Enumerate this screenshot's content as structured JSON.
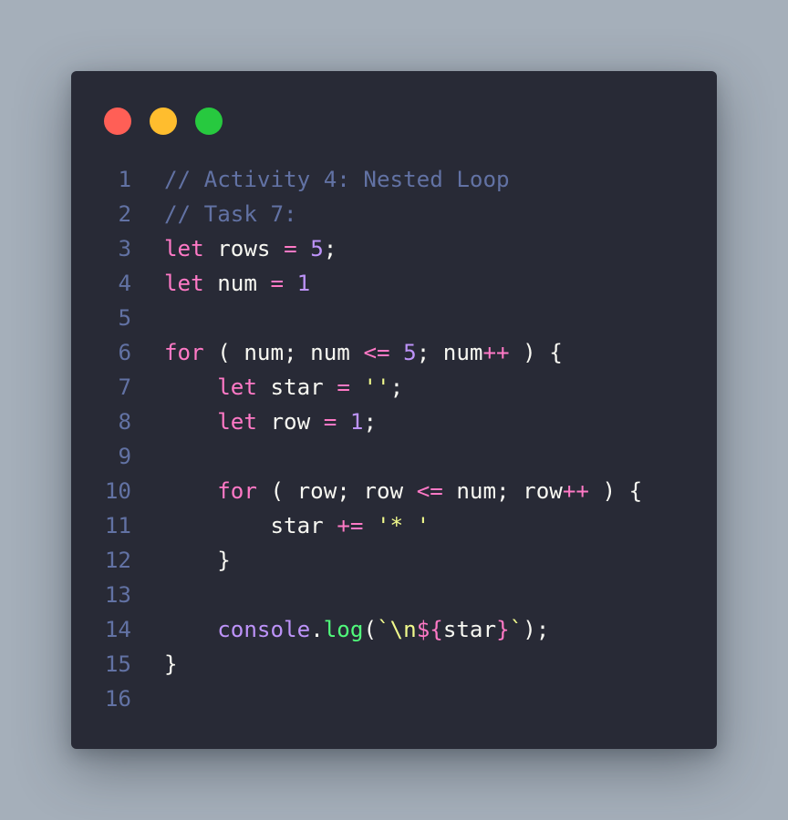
{
  "window": {
    "controls": [
      "close",
      "minimize",
      "zoom"
    ],
    "colors": {
      "background": "#282a36",
      "close": "#ff5f56",
      "minimize": "#ffbd2e",
      "zoom": "#27c93f",
      "page": "#a5afba"
    }
  },
  "code": {
    "line_numbers": [
      "1",
      "2",
      "3",
      "4",
      "5",
      "6",
      "7",
      "8",
      "9",
      "10",
      "11",
      "12",
      "13",
      "14",
      "15",
      "16"
    ],
    "lines": [
      [
        {
          "t": "comment",
          "v": "// Activity 4: Nested Loop"
        }
      ],
      [
        {
          "t": "comment",
          "v": "// Task 7:"
        }
      ],
      [
        {
          "t": "kw",
          "v": "let"
        },
        {
          "t": "txt",
          "v": " rows "
        },
        {
          "t": "op",
          "v": "="
        },
        {
          "t": "txt",
          "v": " "
        },
        {
          "t": "num",
          "v": "5"
        },
        {
          "t": "txt",
          "v": ";"
        }
      ],
      [
        {
          "t": "kw",
          "v": "let"
        },
        {
          "t": "txt",
          "v": " num "
        },
        {
          "t": "op",
          "v": "="
        },
        {
          "t": "txt",
          "v": " "
        },
        {
          "t": "num",
          "v": "1"
        }
      ],
      [],
      [
        {
          "t": "kw",
          "v": "for"
        },
        {
          "t": "txt",
          "v": " ( num; num "
        },
        {
          "t": "op",
          "v": "<="
        },
        {
          "t": "txt",
          "v": " "
        },
        {
          "t": "num",
          "v": "5"
        },
        {
          "t": "txt",
          "v": "; num"
        },
        {
          "t": "op",
          "v": "++"
        },
        {
          "t": "txt",
          "v": " ) {"
        }
      ],
      [
        {
          "t": "txt",
          "v": "    "
        },
        {
          "t": "kw",
          "v": "let"
        },
        {
          "t": "txt",
          "v": " star "
        },
        {
          "t": "op",
          "v": "="
        },
        {
          "t": "txt",
          "v": " "
        },
        {
          "t": "str",
          "v": "''"
        },
        {
          "t": "txt",
          "v": ";"
        }
      ],
      [
        {
          "t": "txt",
          "v": "    "
        },
        {
          "t": "kw",
          "v": "let"
        },
        {
          "t": "txt",
          "v": " row "
        },
        {
          "t": "op",
          "v": "="
        },
        {
          "t": "txt",
          "v": " "
        },
        {
          "t": "num",
          "v": "1"
        },
        {
          "t": "txt",
          "v": ";"
        }
      ],
      [],
      [
        {
          "t": "txt",
          "v": "    "
        },
        {
          "t": "kw",
          "v": "for"
        },
        {
          "t": "txt",
          "v": " ( row; row "
        },
        {
          "t": "op",
          "v": "<="
        },
        {
          "t": "txt",
          "v": " num; row"
        },
        {
          "t": "op",
          "v": "++"
        },
        {
          "t": "txt",
          "v": " ) {"
        }
      ],
      [
        {
          "t": "txt",
          "v": "        star "
        },
        {
          "t": "op",
          "v": "+="
        },
        {
          "t": "txt",
          "v": " "
        },
        {
          "t": "str",
          "v": "'* '"
        }
      ],
      [
        {
          "t": "txt",
          "v": "    }"
        }
      ],
      [],
      [
        {
          "t": "txt",
          "v": "    "
        },
        {
          "t": "obj",
          "v": "console"
        },
        {
          "t": "txt",
          "v": "."
        },
        {
          "t": "fn",
          "v": "log"
        },
        {
          "t": "txt",
          "v": "("
        },
        {
          "t": "str",
          "v": "`\\n"
        },
        {
          "t": "op",
          "v": "${"
        },
        {
          "t": "txt",
          "v": "star"
        },
        {
          "t": "op",
          "v": "}"
        },
        {
          "t": "str",
          "v": "`"
        },
        {
          "t": "txt",
          "v": ");"
        }
      ],
      [
        {
          "t": "txt",
          "v": "}"
        }
      ],
      []
    ]
  }
}
